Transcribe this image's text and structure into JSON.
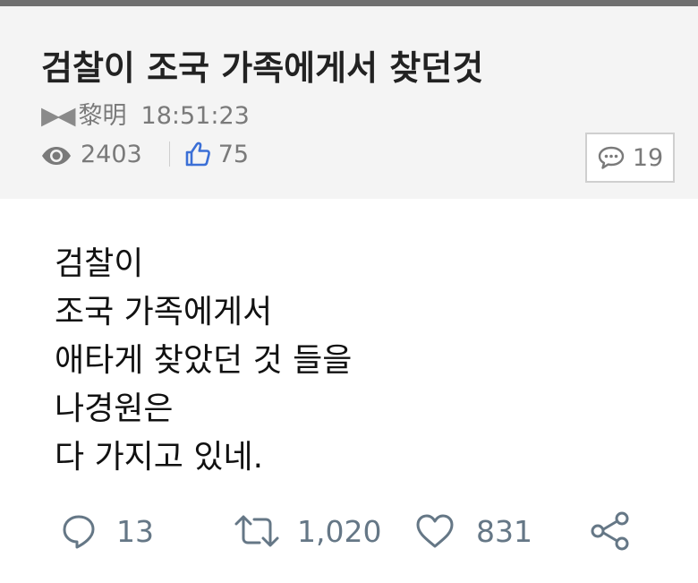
{
  "post": {
    "title": "검찰이 조국 가족에게서 찾던것",
    "author_prefix": "▶◀",
    "author": "黎明",
    "time": "18:51:23",
    "views": "2403",
    "likes": "75",
    "comments": "19"
  },
  "tweet": {
    "lines": [
      "검찰이",
      "조국 가족에게서",
      "애타게 찾았던 것 들을",
      "나경원은",
      "다 가지고 있네."
    ],
    "replies": "13",
    "retweets": "1,020",
    "likes": "831"
  },
  "colors": {
    "header_bg": "#f4f4f4",
    "thumb_blue": "#3b6fd6",
    "tweet_action_gray": "#657786"
  },
  "icons": [
    "eye-icon",
    "thumbs-up-icon",
    "speech-bubble-icon",
    "reply-icon",
    "retweet-icon",
    "heart-icon",
    "share-icon"
  ]
}
